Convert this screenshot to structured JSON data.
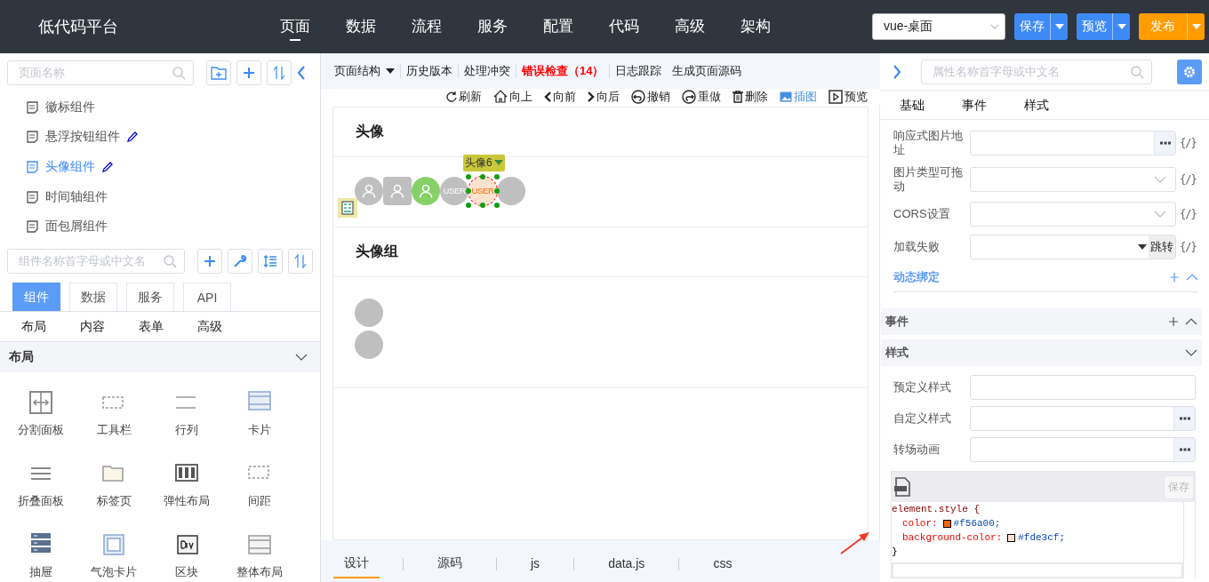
{
  "header": {
    "logo": "低代码平台",
    "nav": [
      {
        "label": "页面",
        "selected": true
      },
      {
        "label": "数据",
        "selected": false
      },
      {
        "label": "流程",
        "selected": false
      },
      {
        "label": "服务",
        "selected": false
      },
      {
        "label": "配置",
        "selected": false
      },
      {
        "label": "代码",
        "selected": false
      },
      {
        "label": "高级",
        "selected": false
      },
      {
        "label": "架构",
        "selected": false
      }
    ],
    "env_select": "vue-桌面",
    "buttons": [
      {
        "label": "保存",
        "kind": "primary"
      },
      {
        "label": "预览",
        "kind": "primary"
      },
      {
        "label": "发布",
        "kind": "warning"
      }
    ]
  },
  "pages_panel": {
    "search": {
      "placeholder": "页面名称"
    },
    "pages": [
      {
        "label": "徽标组件",
        "selected": false,
        "editable": false
      },
      {
        "label": "悬浮按钮组件",
        "selected": false,
        "editable": true
      },
      {
        "label": "头像组件",
        "selected": true,
        "editable": true
      },
      {
        "label": "时间轴组件",
        "selected": false,
        "editable": false
      },
      {
        "label": "面包屑组件",
        "selected": false,
        "editable": false
      }
    ]
  },
  "components_panel": {
    "search": {
      "placeholder": "组件名称首字母或中文名"
    },
    "tabs": [
      {
        "label": "组件",
        "selected": true
      },
      {
        "label": "数据",
        "selected": false
      },
      {
        "label": "服务",
        "selected": false
      },
      {
        "label": "API",
        "selected": false
      }
    ],
    "categories": [
      "布局",
      "内容",
      "表单",
      "高级"
    ],
    "section": {
      "title": "布局",
      "expanded": true
    },
    "items": [
      "分割面板",
      "工具栏",
      "行列",
      "卡片",
      "折叠面板",
      "标签页",
      "弹性布局",
      "间距",
      "抽屉",
      "气泡卡片",
      "区块",
      "整体布局"
    ]
  },
  "toolbar": {
    "menu": [
      {
        "label": "页面结构",
        "kind": "dropdown"
      },
      {
        "label": "历史版本",
        "kind": "link"
      },
      {
        "label": "处理冲突",
        "kind": "link"
      },
      {
        "label": "错误检查（14）",
        "kind": "error"
      },
      {
        "label": "日志跟踪",
        "kind": "link"
      },
      {
        "label": "生成页面源码",
        "kind": "link"
      }
    ],
    "actions": [
      {
        "label": "刷新",
        "active": false
      },
      {
        "label": "向上",
        "active": false
      },
      {
        "label": "向前",
        "active": false
      },
      {
        "label": "向后",
        "active": false
      },
      {
        "label": "撤销",
        "active": false
      },
      {
        "label": "重做",
        "active": false
      },
      {
        "label": "删除",
        "active": false
      },
      {
        "label": "插图",
        "active": true
      },
      {
        "label": "预览",
        "active": false
      }
    ]
  },
  "canvas": {
    "cards": [
      {
        "title": "头像",
        "kind": "row",
        "avatars": [
          {
            "kind": "icon",
            "square": false,
            "color": "#bfbfbf",
            "selected": false
          },
          {
            "kind": "icon",
            "square": true,
            "color": "#bfbfbf",
            "selected": false
          },
          {
            "kind": "icon",
            "square": false,
            "color": "#87d068",
            "selected": false
          },
          {
            "kind": "text",
            "square": false,
            "color": "#bfbfbf",
            "text": "USER",
            "selected": false
          },
          {
            "kind": "text",
            "square": false,
            "color": "#fde3cf",
            "text": "USER",
            "selected": true,
            "tag": "头像6"
          },
          {
            "kind": "blank",
            "square": false,
            "color": "#bfbfbf",
            "selected": false
          }
        ]
      },
      {
        "title": "头像组",
        "kind": "column",
        "avatars": [
          {
            "kind": "blank",
            "square": false,
            "color": "#bfbfbf",
            "selected": false
          },
          {
            "kind": "blank",
            "square": false,
            "color": "#bfbfbf",
            "selected": false
          }
        ]
      }
    ]
  },
  "bottom_tabs": [
    {
      "label": "设计",
      "selected": true
    },
    {
      "label": "源码",
      "selected": false
    },
    {
      "label": "js",
      "selected": false
    },
    {
      "label": "data.js",
      "selected": false
    },
    {
      "label": "css",
      "selected": false
    }
  ],
  "properties_panel": {
    "search": {
      "placeholder": "属性名称首字母或中文名"
    },
    "tabs": [
      "基础",
      "事件",
      "样式"
    ],
    "fields": [
      {
        "label": "响应式图片地址",
        "kind": "more",
        "binding": "{/}"
      },
      {
        "label": "图片类型可拖动",
        "kind": "select",
        "binding": "{/}"
      },
      {
        "label": "CORS设置",
        "kind": "select",
        "binding": "{/}"
      },
      {
        "label": "加载失败",
        "kind": "dropdown-button",
        "button": "跳转",
        "binding": "{/}"
      }
    ],
    "dynamic_binding": {
      "title": "动态绑定",
      "expanded": true
    },
    "sections": [
      {
        "title": "事件",
        "expanded": true,
        "addable": true
      },
      {
        "title": "样式",
        "expanded": false,
        "addable": false
      }
    ],
    "style_fields": [
      {
        "label": "预定义样式",
        "kind": "input"
      },
      {
        "label": "自定义样式",
        "kind": "more"
      },
      {
        "label": "转场动画",
        "kind": "more"
      }
    ],
    "code_editor": {
      "save_button": {
        "label": "保存",
        "disabled": true
      },
      "lines": [
        {
          "kind": "selector",
          "text": "element.style {"
        },
        {
          "kind": "prop",
          "property": "color:",
          "color": "#f56a00",
          "value": "#f56a00;"
        },
        {
          "kind": "prop",
          "property": "background-color:",
          "color": "#fde3cf",
          "value": "#fde3cf;"
        },
        {
          "kind": "close",
          "text": "}"
        }
      ]
    }
  }
}
